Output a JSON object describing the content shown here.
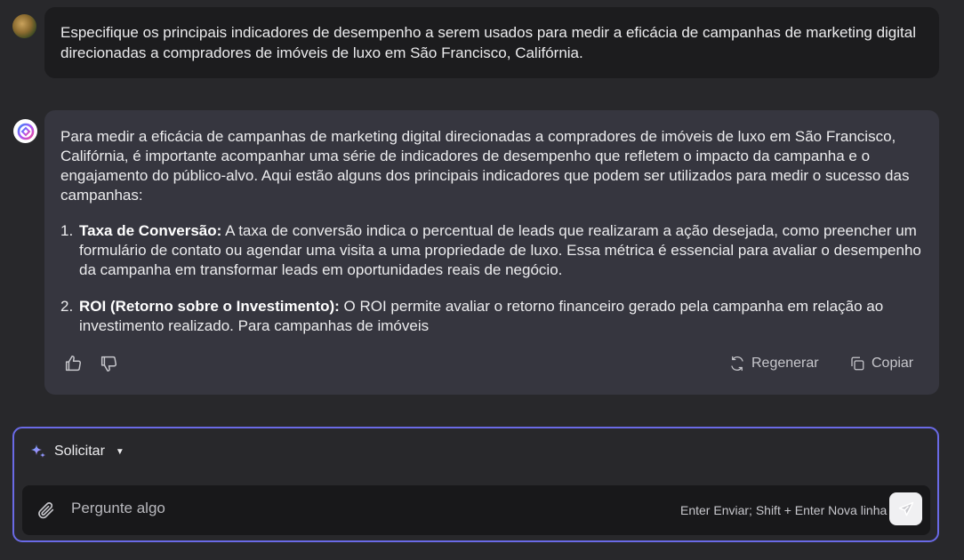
{
  "user_message": {
    "text": "Especifique os principais indicadores de desempenho a serem usados para medir a eficácia de campanhas de marketing digital direcionadas a compradores de imóveis de luxo em São Francisco, Califórnia."
  },
  "assistant_message": {
    "intro": "Para medir a eficácia de campanhas de marketing digital direcionadas a compradores de imóveis de luxo em São Francisco, Califórnia, é importante acompanhar uma série de indicadores de desempenho que refletem o impacto da campanha e o engajamento do público-alvo. Aqui estão alguns dos principais indicadores que podem ser utilizados para medir o sucesso das campanhas:",
    "items": [
      {
        "number": "1.",
        "title": "Taxa de Conversão:",
        "text": " A taxa de conversão indica o percentual de leads que realizaram a ação desejada, como preencher um formulário de contato ou agendar uma visita a uma propriedade de luxo. Essa métrica é essencial para avaliar o desempenho da campanha em transformar leads em oportunidades reais de negócio."
      },
      {
        "number": "2.",
        "title": "ROI (Retorno sobre o Investimento):",
        "text": " O ROI permite avaliar o retorno financeiro gerado pela campanha em relação ao investimento realizado. Para campanhas de imóveis"
      }
    ],
    "actions": {
      "regenerate": "Regenerar",
      "copy": "Copiar"
    }
  },
  "composer": {
    "mode_label": "Solicitar",
    "placeholder": "Pergunte algo",
    "hint": "Enter Enviar; Shift + Enter Nova linha"
  },
  "colors": {
    "accent_border": "#6a6ae6",
    "background": "#28282b",
    "assistant_bubble": "#36363f",
    "user_bubble": "#1c1c1e"
  }
}
